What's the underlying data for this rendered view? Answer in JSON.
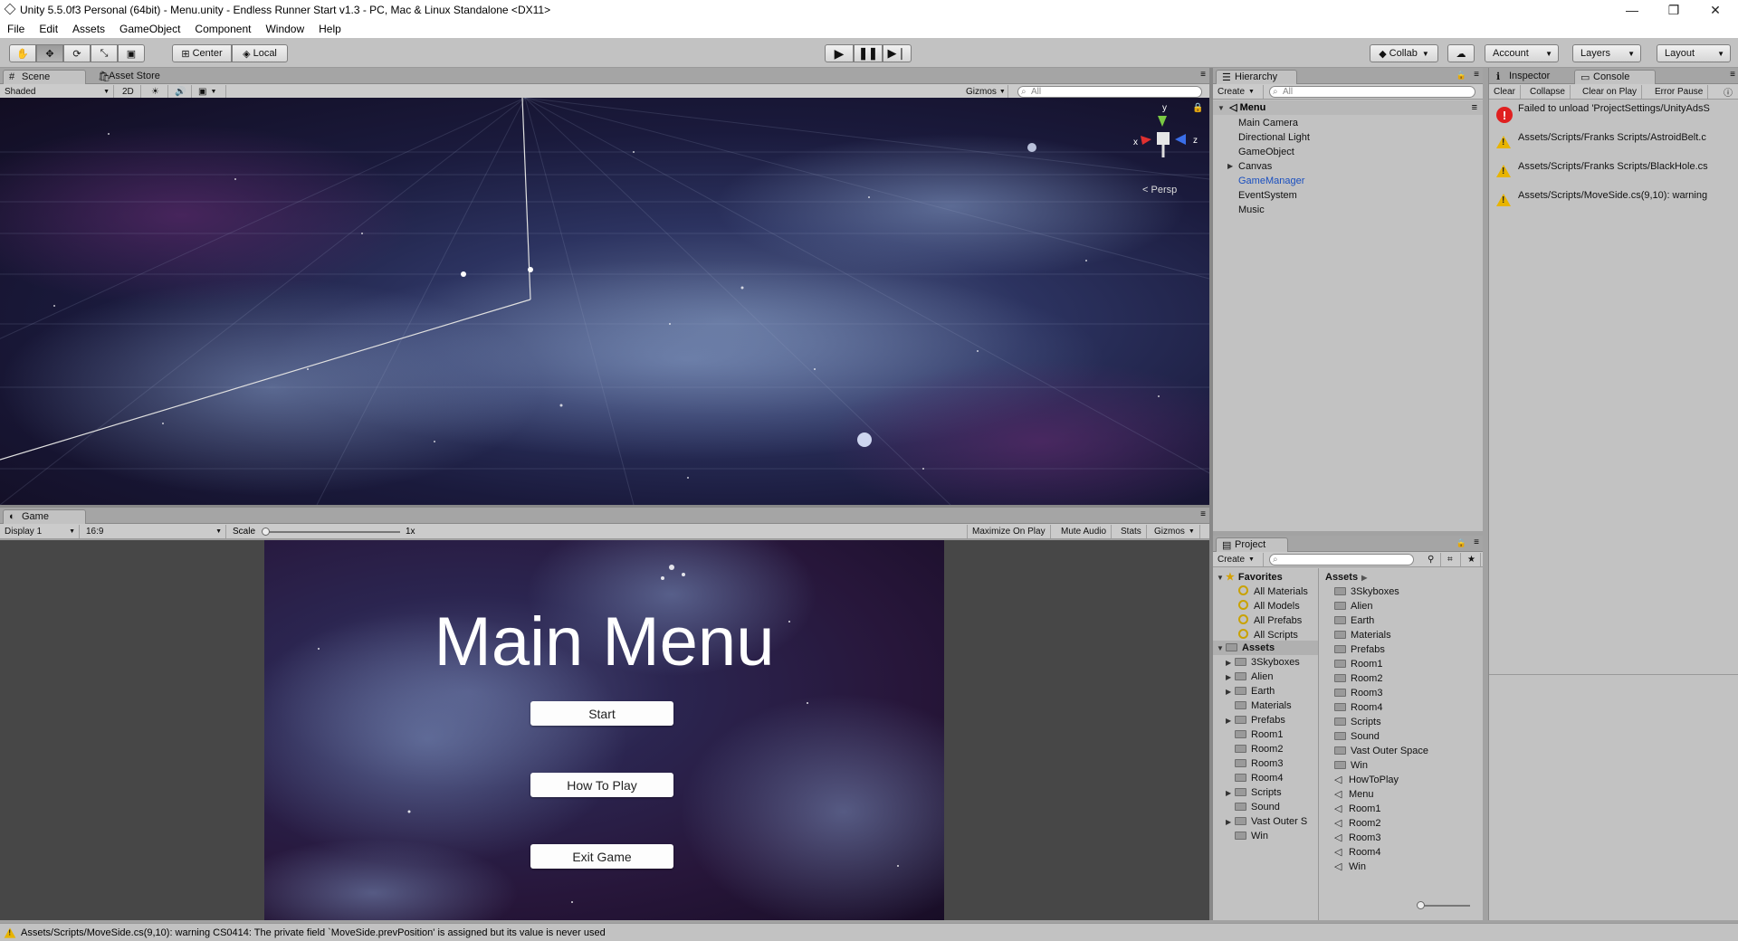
{
  "window": {
    "title": "Unity 5.5.0f3 Personal (64bit) - Menu.unity - Endless Runner Start v1.3 - PC, Mac & Linux Standalone <DX11>",
    "minimize": "—",
    "maximize": "❐",
    "close": "✕"
  },
  "menu": [
    "File",
    "Edit",
    "Assets",
    "GameObject",
    "Component",
    "Window",
    "Help"
  ],
  "toolbar": {
    "center_label": "Center",
    "local_label": "Local",
    "collab_label": "Collab",
    "account_label": "Account",
    "layers_label": "Layers",
    "layout_label": "Layout"
  },
  "scene": {
    "tab_label": "Scene",
    "asset_store_label": "Asset Store",
    "shading_mode": "Shaded",
    "mode_2d": "2D",
    "gizmos_label": "Gizmos",
    "search_placeholder": "All",
    "persp_label": "Persp",
    "axis_y": "y",
    "axis_x": "x",
    "axis_z": "z"
  },
  "game": {
    "tab_label": "Game",
    "display": "Display 1",
    "aspect": "16:9",
    "scale_label": "Scale",
    "scale_value": "1x",
    "maximize_label": "Maximize On Play",
    "mute_label": "Mute Audio",
    "stats_label": "Stats",
    "gizmos_label": "Gizmos",
    "menu_title": "Main Menu",
    "buttons": [
      "Start",
      "How To Play",
      "Exit Game"
    ]
  },
  "hierarchy": {
    "tab_label": "Hierarchy",
    "create_label": "Create",
    "search_placeholder": "All",
    "scene_name": "Menu",
    "items": [
      {
        "label": "Main Camera",
        "expandable": false,
        "selected": false
      },
      {
        "label": "Directional Light",
        "expandable": false,
        "selected": false
      },
      {
        "label": "GameObject",
        "expandable": false,
        "selected": false
      },
      {
        "label": "Canvas",
        "expandable": true,
        "selected": false
      },
      {
        "label": "GameManager",
        "expandable": false,
        "selected": true
      },
      {
        "label": "EventSystem",
        "expandable": false,
        "selected": false
      },
      {
        "label": "Music",
        "expandable": false,
        "selected": false
      }
    ]
  },
  "console": {
    "inspector_tab": "Inspector",
    "console_tab": "Console",
    "clear_label": "Clear",
    "collapse_label": "Collapse",
    "clear_on_play_label": "Clear on Play",
    "error_pause_label": "Error Pause",
    "entries": [
      {
        "type": "error",
        "text": "Failed to unload 'ProjectSettings/UnityAdsS"
      },
      {
        "type": "warning",
        "text": "Assets/Scripts/Franks Scripts/AstroidBelt.c"
      },
      {
        "type": "warning",
        "text": "Assets/Scripts/Franks Scripts/BlackHole.cs"
      },
      {
        "type": "warning",
        "text": "Assets/Scripts/MoveSide.cs(9,10): warning"
      }
    ]
  },
  "project": {
    "tab_label": "Project",
    "create_label": "Create",
    "favorites_label": "Favorites",
    "favorites": [
      "All Materials",
      "All Models",
      "All Prefabs",
      "All Scripts"
    ],
    "assets_label": "Assets",
    "tree": [
      {
        "label": "3Skyboxes",
        "expandable": true
      },
      {
        "label": "Alien",
        "expandable": true
      },
      {
        "label": "Earth",
        "expandable": true
      },
      {
        "label": "Materials",
        "expandable": false
      },
      {
        "label": "Prefabs",
        "expandable": true
      },
      {
        "label": "Room1",
        "expandable": false
      },
      {
        "label": "Room2",
        "expandable": false
      },
      {
        "label": "Room3",
        "expandable": false
      },
      {
        "label": "Room4",
        "expandable": false
      },
      {
        "label": "Scripts",
        "expandable": true
      },
      {
        "label": "Sound",
        "expandable": false
      },
      {
        "label": "Vast Outer S",
        "expandable": true
      },
      {
        "label": "Win",
        "expandable": false
      }
    ],
    "breadcrumb": "Assets",
    "contents": [
      {
        "label": "3Skyboxes",
        "kind": "folder"
      },
      {
        "label": "Alien",
        "kind": "folder"
      },
      {
        "label": "Earth",
        "kind": "folder"
      },
      {
        "label": "Materials",
        "kind": "folder"
      },
      {
        "label": "Prefabs",
        "kind": "folder"
      },
      {
        "label": "Room1",
        "kind": "folder"
      },
      {
        "label": "Room2",
        "kind": "folder"
      },
      {
        "label": "Room3",
        "kind": "folder"
      },
      {
        "label": "Room4",
        "kind": "folder"
      },
      {
        "label": "Scripts",
        "kind": "folder"
      },
      {
        "label": "Sound",
        "kind": "folder"
      },
      {
        "label": "Vast Outer Space",
        "kind": "folder"
      },
      {
        "label": "Win",
        "kind": "folder"
      },
      {
        "label": "HowToPlay",
        "kind": "scene"
      },
      {
        "label": "Menu",
        "kind": "scene"
      },
      {
        "label": "Room1",
        "kind": "scene"
      },
      {
        "label": "Room2",
        "kind": "scene"
      },
      {
        "label": "Room3",
        "kind": "scene"
      },
      {
        "label": "Room4",
        "kind": "scene"
      },
      {
        "label": "Win",
        "kind": "scene"
      }
    ]
  },
  "status": {
    "message": "Assets/Scripts/MoveSide.cs(9,10): warning CS0414: The private field `MoveSide.prevPosition' is assigned but its value is never used"
  }
}
